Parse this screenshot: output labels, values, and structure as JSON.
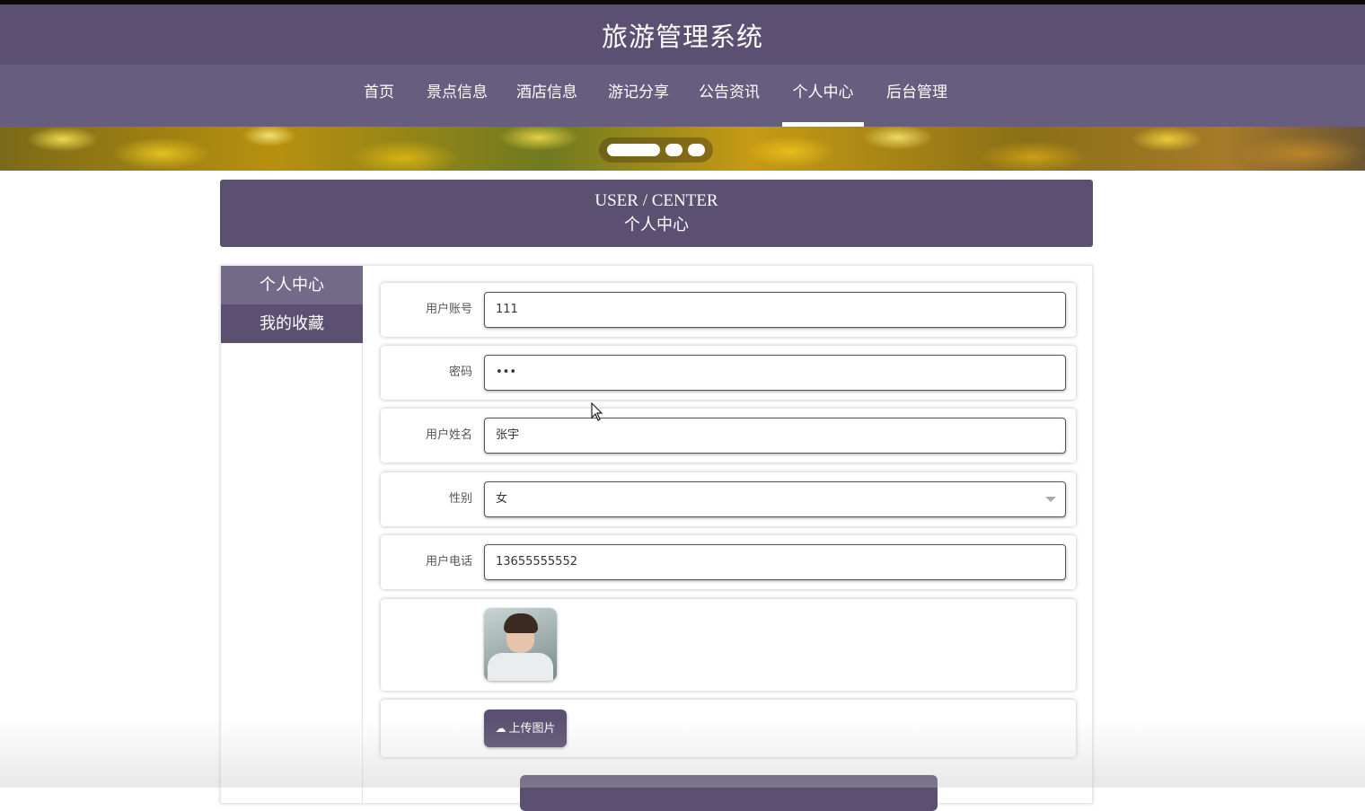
{
  "header": {
    "title": "旅游管理系统"
  },
  "nav": {
    "items": [
      {
        "label": "首页"
      },
      {
        "label": "景点信息"
      },
      {
        "label": "酒店信息"
      },
      {
        "label": "游记分享"
      },
      {
        "label": "公告资讯"
      },
      {
        "label": "个人中心"
      },
      {
        "label": "后台管理"
      }
    ],
    "active": "个人中心"
  },
  "banner": {
    "indicator_count": 3,
    "active_indicator": 1
  },
  "page_banner": {
    "en": "USER / CENTER",
    "cn": "个人中心"
  },
  "sidebar": {
    "items": [
      {
        "label": "个人中心"
      },
      {
        "label": "我的收藏"
      }
    ]
  },
  "form": {
    "account": {
      "label": "用户账号",
      "value": "111"
    },
    "password": {
      "label": "密码",
      "value": "•••"
    },
    "name": {
      "label": "用户姓名",
      "value": "张宇"
    },
    "gender": {
      "label": "性别",
      "value": "女"
    },
    "phone": {
      "label": "用户电话",
      "value": "13655555552"
    },
    "upload_label": "上传图片"
  },
  "colors": {
    "primary": "#5b5071",
    "nav_bg": "#675d7e",
    "sidebar_active": "#736a89"
  },
  "icons": {
    "upload": "cloud-upload-icon",
    "select": "chevron-down-icon"
  }
}
